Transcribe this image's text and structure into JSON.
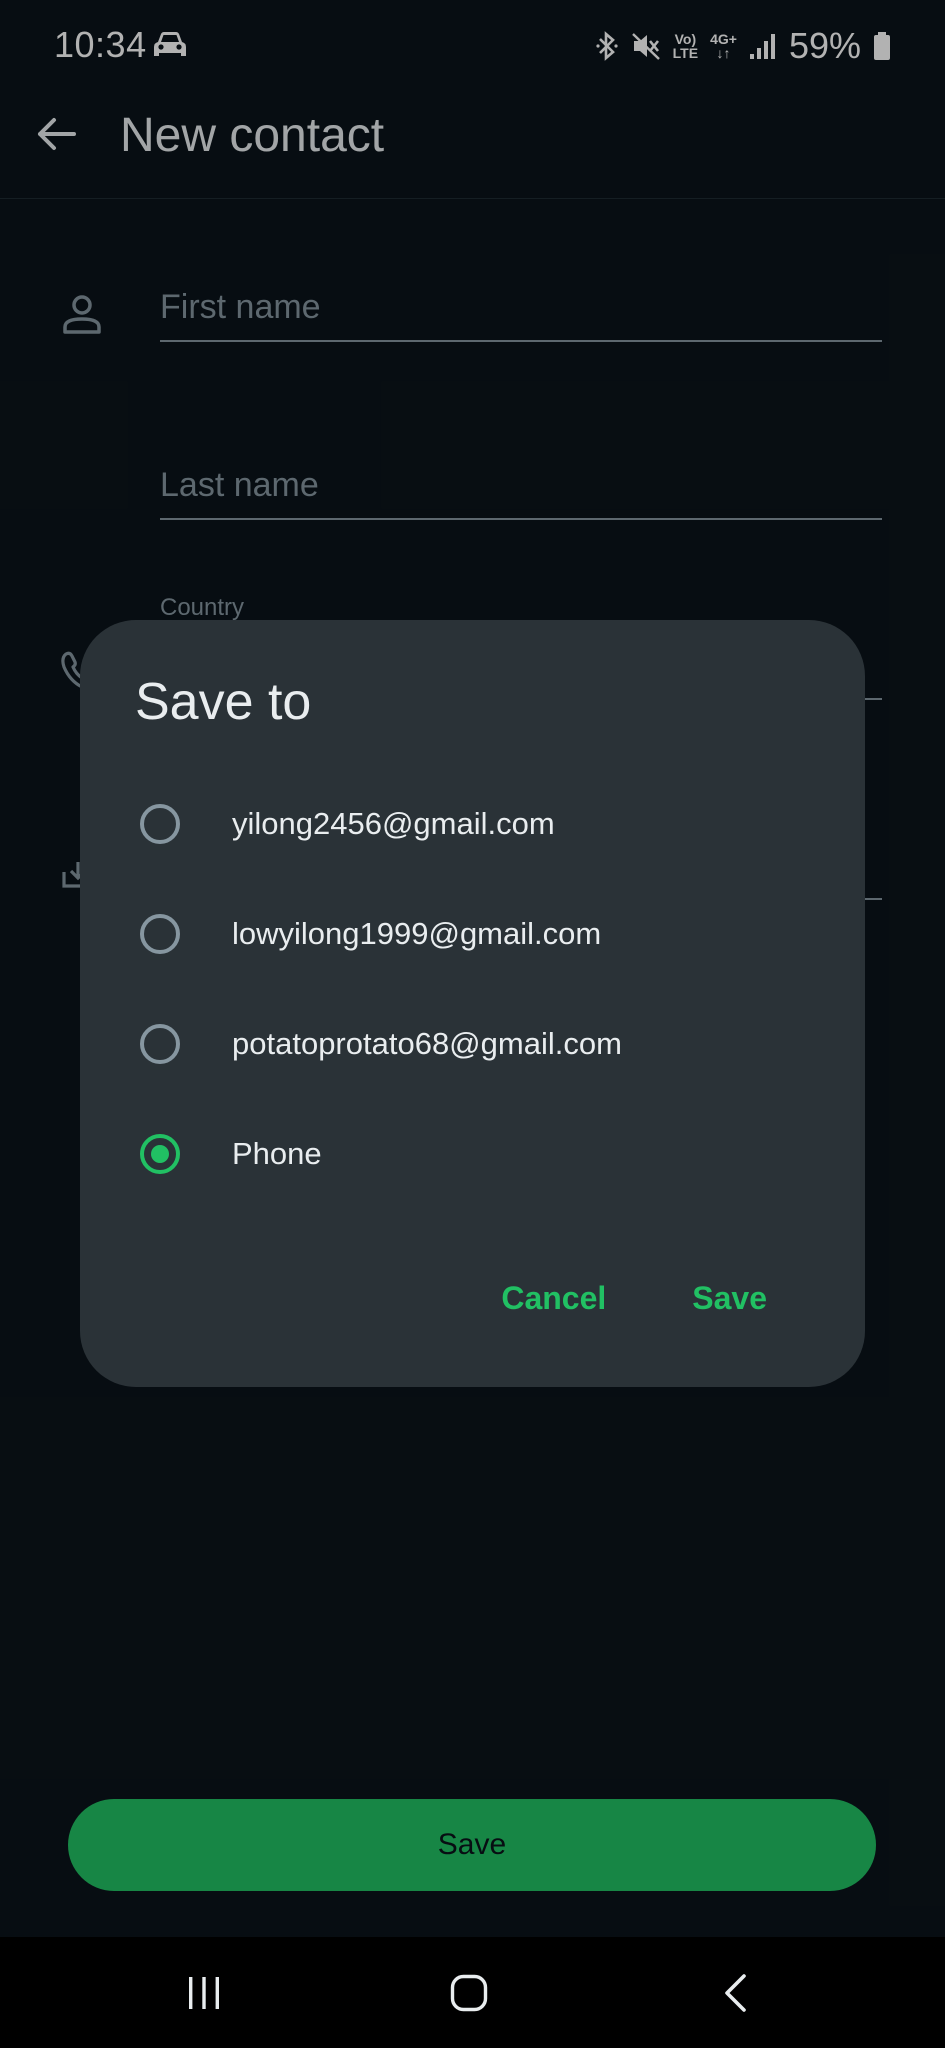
{
  "status_bar": {
    "time": "10:34",
    "network_top": "Vo)",
    "network_bottom": "LTE",
    "data_top": "4G+",
    "data_bottom": "↓↑",
    "battery": "59%"
  },
  "app_bar": {
    "title": "New contact"
  },
  "form": {
    "first_name_placeholder": "First name",
    "last_name_placeholder": "Last name",
    "country_label": "Country"
  },
  "dialog": {
    "title": "Save to",
    "options": [
      {
        "label": "yilong2456@gmail.com",
        "selected": false
      },
      {
        "label": "lowyilong1999@gmail.com",
        "selected": false
      },
      {
        "label": "potatoprotato68@gmail.com",
        "selected": false
      },
      {
        "label": "Phone",
        "selected": true
      }
    ],
    "cancel_label": "Cancel",
    "save_label": "Save"
  },
  "bottom_button": {
    "label": "Save"
  },
  "colors": {
    "accent": "#21c063",
    "background": "#0b141a",
    "dialog": "#2a3237"
  }
}
